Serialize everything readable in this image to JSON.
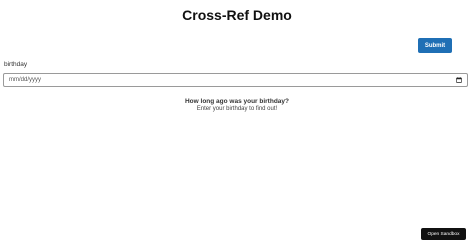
{
  "page": {
    "title": "Cross-Ref Demo"
  },
  "form": {
    "submit_label": "Submit",
    "birthday_label": "birthday",
    "birthday_placeholder": "mm/dd/yyyy"
  },
  "prompt": {
    "question": "How long ago was your birthday?",
    "instruction": "Enter your birthday to find out!"
  },
  "footer": {
    "sandbox_label": "Open Sandbox"
  },
  "icons": {
    "calendar": "calendar-icon"
  },
  "colors": {
    "primary_button": "#1f6fb5",
    "sandbox_button": "#111111"
  }
}
